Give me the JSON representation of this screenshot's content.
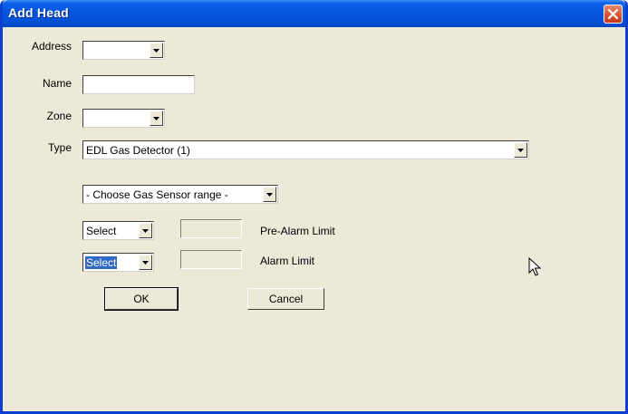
{
  "window": {
    "title": "Add Head"
  },
  "form": {
    "address": {
      "label": "Address",
      "value": ""
    },
    "name": {
      "label": "Name",
      "value": ""
    },
    "zone": {
      "label": "Zone",
      "value": ""
    },
    "type": {
      "label": "Type",
      "value": "EDL Gas Detector (1)"
    },
    "gas_sensor_range": {
      "value": "- Choose Gas Sensor range -"
    },
    "pre_alarm": {
      "select_value": "Select",
      "limit_value": "",
      "label": "Pre-Alarm Limit"
    },
    "alarm": {
      "select_value": "Select",
      "limit_value": "",
      "label": "Alarm Limit"
    }
  },
  "buttons": {
    "ok": "OK",
    "cancel": "Cancel"
  },
  "icons": {
    "close": "close-icon",
    "dropdown": "chevron-down-icon",
    "cursor": "mouse-pointer-icon"
  },
  "colors": {
    "titlebar": "#0655dc",
    "dialog_bg": "#ece9d8",
    "close_button": "#d8502e",
    "selection": "#316ac5"
  }
}
